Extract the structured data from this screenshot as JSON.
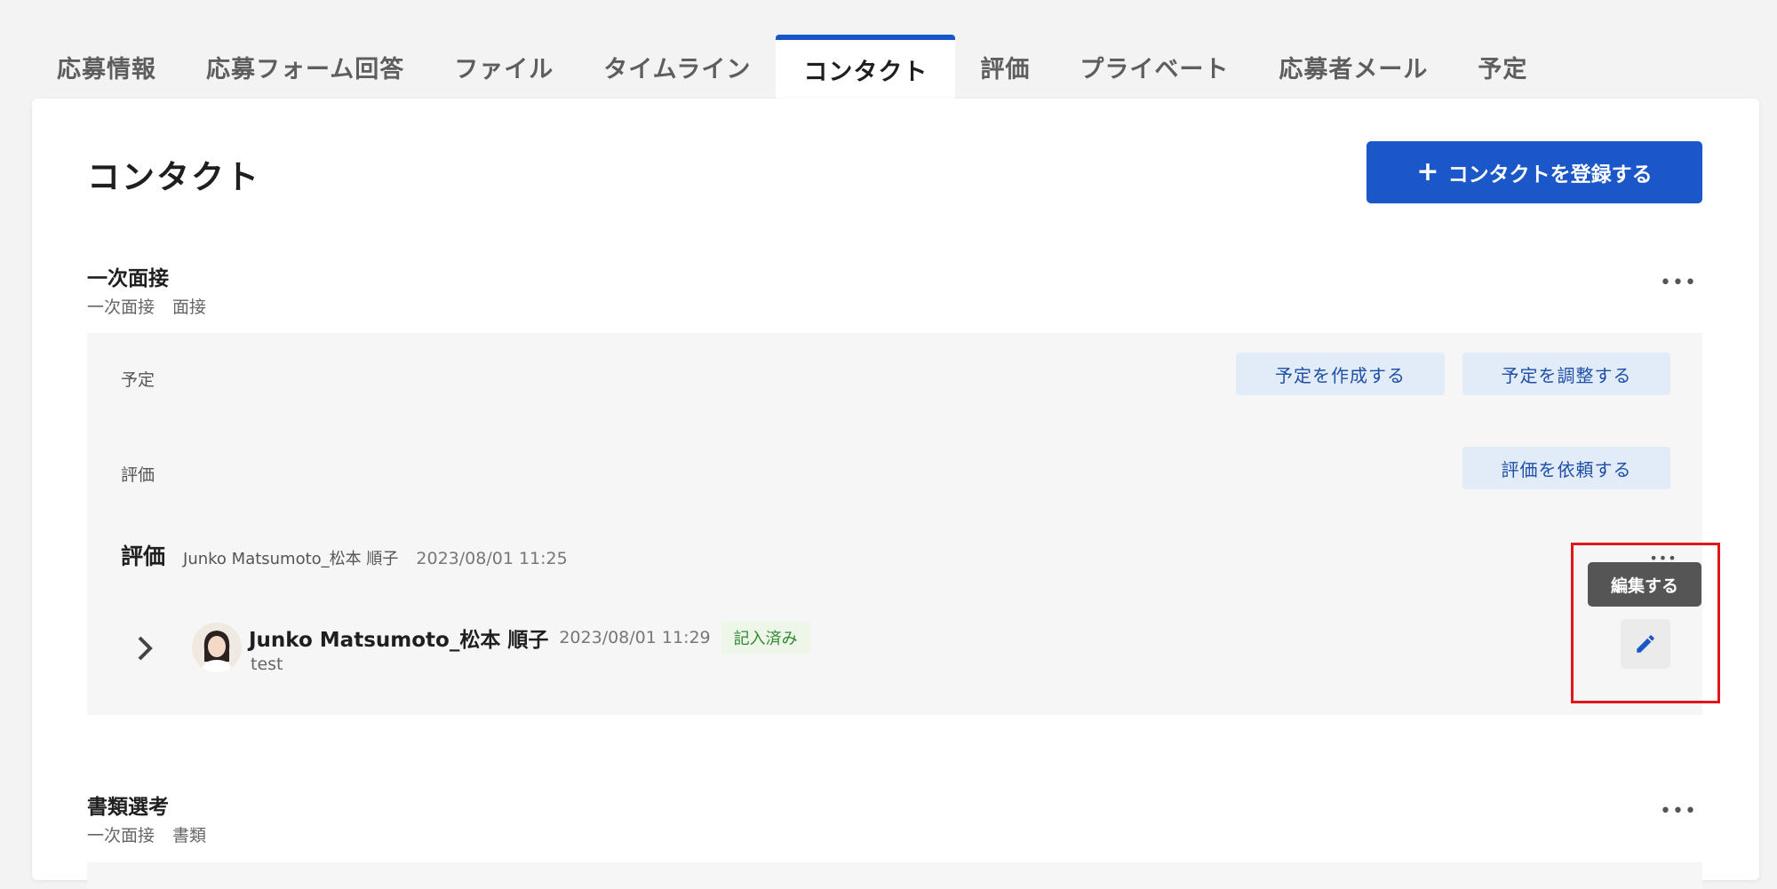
{
  "tabs": [
    {
      "label": "応募情報"
    },
    {
      "label": "応募フォーム回答"
    },
    {
      "label": "ファイル"
    },
    {
      "label": "タイムライン"
    },
    {
      "label": "コンタクト",
      "active": true
    },
    {
      "label": "評価"
    },
    {
      "label": "プライベート"
    },
    {
      "label": "応募者メール"
    },
    {
      "label": "予定"
    }
  ],
  "page": {
    "title": "コンタクト",
    "add_button": "コンタクトを登録する"
  },
  "sections": [
    {
      "title": "一次面接",
      "sub": [
        "一次面接",
        "面接"
      ],
      "rows": {
        "schedule_label": "予定",
        "create_schedule": "予定を作成する",
        "adjust_schedule": "予定を調整する",
        "eval_label": "評価",
        "request_eval": "評価を依頼する"
      },
      "evaluation": {
        "heading": "評価",
        "requester": "Junko Matsumoto_松本 順子",
        "timestamp": "2023/08/01 11:25",
        "entry": {
          "name": "Junko Matsumoto_松本 順子",
          "timestamp": "2023/08/01 11:29",
          "status": "記入済み",
          "comment": "test"
        }
      }
    },
    {
      "title": "書類選考",
      "sub": [
        "一次面接",
        "書類"
      ]
    }
  ],
  "tooltip": "編集する",
  "more_glyph": "•••",
  "colors": {
    "accent": "#1b57c8",
    "highlight": "#e0161c",
    "status_green": "#2f8a2f"
  }
}
